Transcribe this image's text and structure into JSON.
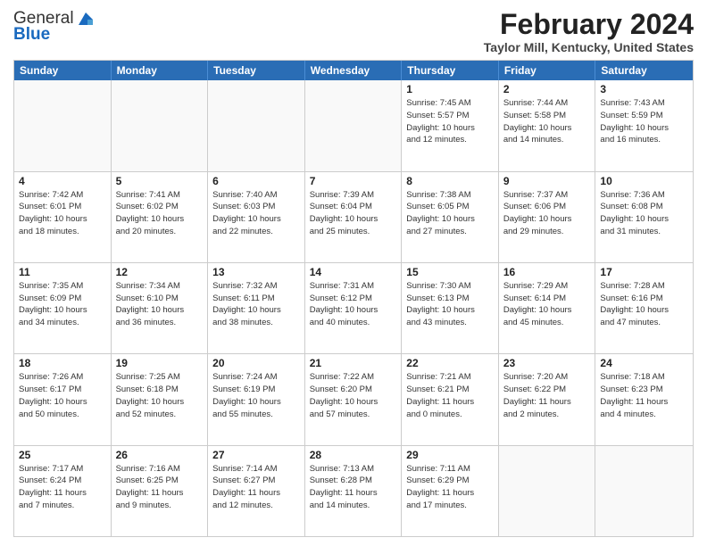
{
  "header": {
    "logo_general": "General",
    "logo_blue": "Blue",
    "month_title": "February 2024",
    "location": "Taylor Mill, Kentucky, United States"
  },
  "day_headers": [
    "Sunday",
    "Monday",
    "Tuesday",
    "Wednesday",
    "Thursday",
    "Friday",
    "Saturday"
  ],
  "weeks": [
    [
      {
        "day": "",
        "info": ""
      },
      {
        "day": "",
        "info": ""
      },
      {
        "day": "",
        "info": ""
      },
      {
        "day": "",
        "info": ""
      },
      {
        "day": "1",
        "info": "Sunrise: 7:45 AM\nSunset: 5:57 PM\nDaylight: 10 hours\nand 12 minutes."
      },
      {
        "day": "2",
        "info": "Sunrise: 7:44 AM\nSunset: 5:58 PM\nDaylight: 10 hours\nand 14 minutes."
      },
      {
        "day": "3",
        "info": "Sunrise: 7:43 AM\nSunset: 5:59 PM\nDaylight: 10 hours\nand 16 minutes."
      }
    ],
    [
      {
        "day": "4",
        "info": "Sunrise: 7:42 AM\nSunset: 6:01 PM\nDaylight: 10 hours\nand 18 minutes."
      },
      {
        "day": "5",
        "info": "Sunrise: 7:41 AM\nSunset: 6:02 PM\nDaylight: 10 hours\nand 20 minutes."
      },
      {
        "day": "6",
        "info": "Sunrise: 7:40 AM\nSunset: 6:03 PM\nDaylight: 10 hours\nand 22 minutes."
      },
      {
        "day": "7",
        "info": "Sunrise: 7:39 AM\nSunset: 6:04 PM\nDaylight: 10 hours\nand 25 minutes."
      },
      {
        "day": "8",
        "info": "Sunrise: 7:38 AM\nSunset: 6:05 PM\nDaylight: 10 hours\nand 27 minutes."
      },
      {
        "day": "9",
        "info": "Sunrise: 7:37 AM\nSunset: 6:06 PM\nDaylight: 10 hours\nand 29 minutes."
      },
      {
        "day": "10",
        "info": "Sunrise: 7:36 AM\nSunset: 6:08 PM\nDaylight: 10 hours\nand 31 minutes."
      }
    ],
    [
      {
        "day": "11",
        "info": "Sunrise: 7:35 AM\nSunset: 6:09 PM\nDaylight: 10 hours\nand 34 minutes."
      },
      {
        "day": "12",
        "info": "Sunrise: 7:34 AM\nSunset: 6:10 PM\nDaylight: 10 hours\nand 36 minutes."
      },
      {
        "day": "13",
        "info": "Sunrise: 7:32 AM\nSunset: 6:11 PM\nDaylight: 10 hours\nand 38 minutes."
      },
      {
        "day": "14",
        "info": "Sunrise: 7:31 AM\nSunset: 6:12 PM\nDaylight: 10 hours\nand 40 minutes."
      },
      {
        "day": "15",
        "info": "Sunrise: 7:30 AM\nSunset: 6:13 PM\nDaylight: 10 hours\nand 43 minutes."
      },
      {
        "day": "16",
        "info": "Sunrise: 7:29 AM\nSunset: 6:14 PM\nDaylight: 10 hours\nand 45 minutes."
      },
      {
        "day": "17",
        "info": "Sunrise: 7:28 AM\nSunset: 6:16 PM\nDaylight: 10 hours\nand 47 minutes."
      }
    ],
    [
      {
        "day": "18",
        "info": "Sunrise: 7:26 AM\nSunset: 6:17 PM\nDaylight: 10 hours\nand 50 minutes."
      },
      {
        "day": "19",
        "info": "Sunrise: 7:25 AM\nSunset: 6:18 PM\nDaylight: 10 hours\nand 52 minutes."
      },
      {
        "day": "20",
        "info": "Sunrise: 7:24 AM\nSunset: 6:19 PM\nDaylight: 10 hours\nand 55 minutes."
      },
      {
        "day": "21",
        "info": "Sunrise: 7:22 AM\nSunset: 6:20 PM\nDaylight: 10 hours\nand 57 minutes."
      },
      {
        "day": "22",
        "info": "Sunrise: 7:21 AM\nSunset: 6:21 PM\nDaylight: 11 hours\nand 0 minutes."
      },
      {
        "day": "23",
        "info": "Sunrise: 7:20 AM\nSunset: 6:22 PM\nDaylight: 11 hours\nand 2 minutes."
      },
      {
        "day": "24",
        "info": "Sunrise: 7:18 AM\nSunset: 6:23 PM\nDaylight: 11 hours\nand 4 minutes."
      }
    ],
    [
      {
        "day": "25",
        "info": "Sunrise: 7:17 AM\nSunset: 6:24 PM\nDaylight: 11 hours\nand 7 minutes."
      },
      {
        "day": "26",
        "info": "Sunrise: 7:16 AM\nSunset: 6:25 PM\nDaylight: 11 hours\nand 9 minutes."
      },
      {
        "day": "27",
        "info": "Sunrise: 7:14 AM\nSunset: 6:27 PM\nDaylight: 11 hours\nand 12 minutes."
      },
      {
        "day": "28",
        "info": "Sunrise: 7:13 AM\nSunset: 6:28 PM\nDaylight: 11 hours\nand 14 minutes."
      },
      {
        "day": "29",
        "info": "Sunrise: 7:11 AM\nSunset: 6:29 PM\nDaylight: 11 hours\nand 17 minutes."
      },
      {
        "day": "",
        "info": ""
      },
      {
        "day": "",
        "info": ""
      }
    ]
  ]
}
